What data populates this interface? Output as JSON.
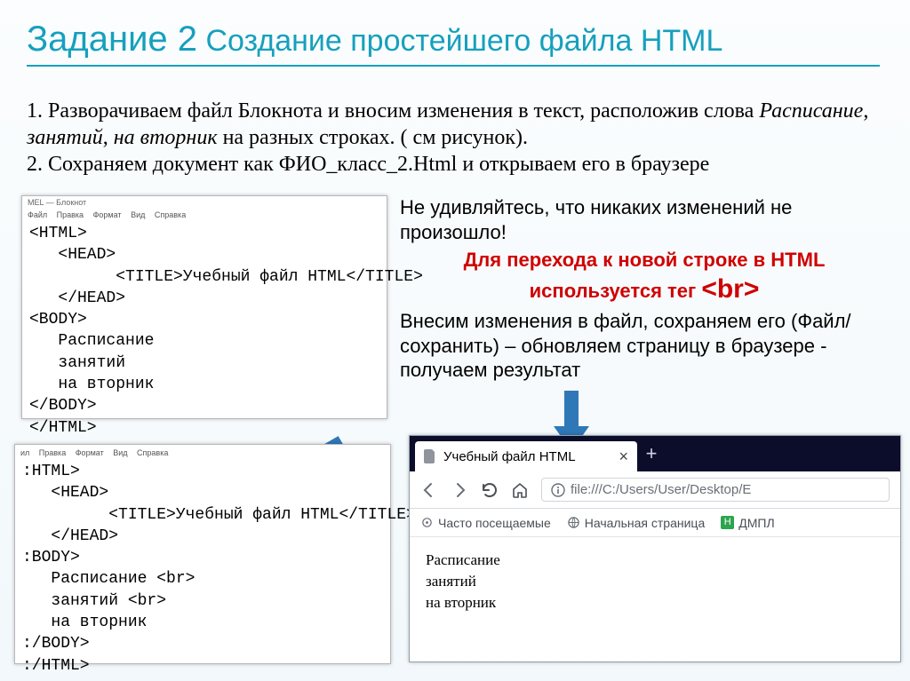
{
  "title": {
    "big": "Задание 2",
    "small": " Создание простейшего файла HTML"
  },
  "instructions": {
    "line1a": "1. Разворачиваем файл Блокнота и вносим изменения в текст, расположив слова ",
    "w1": "Расписание",
    "c1": ", ",
    "w2": "занятий",
    "c2": ", ",
    "w3": "на вторник",
    "line1b": " на разных строках. ( см рисунок).",
    "line2": "2. Сохраняем документ как ФИО_класс_2.Html и открываем его в браузере"
  },
  "notepad1": {
    "title": "MEL — Блокнот",
    "menu": {
      "file": "Файл",
      "edit": "Правка",
      "format": "Формат",
      "view": "Вид",
      "help": "Справка"
    },
    "code": "<HTML>\n   <HEAD>\n         <TITLE>Учебный файл HTML</TITLE>\n   </HEAD>\n<BODY>\n   Расписание\n   занятий\n   на вторник\n</BODY>\n</HTML>"
  },
  "right": {
    "p1": "Не удивляйтесь, что никаких изменений не произошло!",
    "red_a": "Для перехода к новой строке в HTML используется тег ",
    "red_b": "<br>",
    "p2": "Внесим изменения в файл, сохраняем его (Файл/сохранить) – обновляем страницу в браузере - получаем результат"
  },
  "notepad2": {
    "menu": {
      "file": "ил",
      "edit": "Правка",
      "format": "Формат",
      "view": "Вид",
      "help": "Справка"
    },
    "code": ":HTML>\n   <HEAD>\n         <TITLE>Учебный файл HTML</TITLE>\n   </HEAD>\n:BODY>\n   Расписание <br>\n   занятий <br>\n   на вторник\n:/BODY>\n:/HTML>"
  },
  "browser": {
    "tab_title": "Учебный файл HTML",
    "url": "file:///C:/Users/User/Desktop/E",
    "bookmarks": {
      "b1": "Часто посещаемые",
      "b2": "Начальная страница",
      "b3": "ДМПЛ"
    },
    "page_l1": "Расписание",
    "page_l2": "занятий",
    "page_l3": "на вторник"
  }
}
